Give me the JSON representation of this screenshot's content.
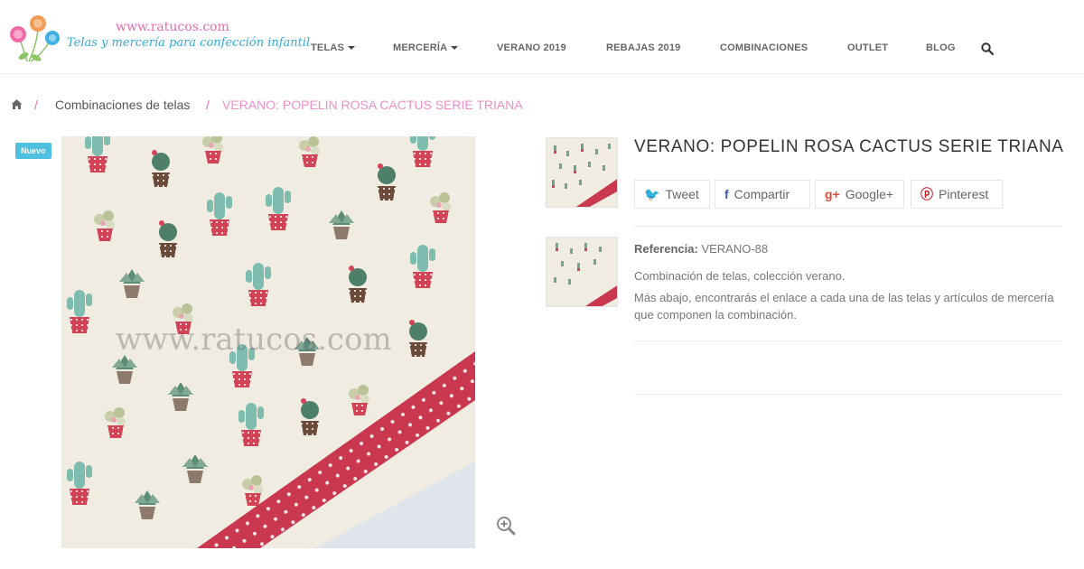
{
  "logo": {
    "url_text": "www.ratucos.com",
    "tagline": "Telas y mercería para confección infantil"
  },
  "nav": {
    "items": [
      {
        "label": "TELAS",
        "dropdown": true
      },
      {
        "label": "MERCERÍA",
        "dropdown": true
      },
      {
        "label": "VERANO 2019",
        "dropdown": false
      },
      {
        "label": "REBAJAS 2019",
        "dropdown": false
      },
      {
        "label": "COMBINACIONES",
        "dropdown": false
      },
      {
        "label": "OUTLET",
        "dropdown": false
      },
      {
        "label": "BLOG",
        "dropdown": false
      }
    ],
    "search_icon": "search-icon"
  },
  "breadcrumb": {
    "home_icon": "home-icon",
    "separator": "/",
    "link": "Combinaciones de telas",
    "current": "VERANO: POPELIN ROSA CACTUS SERIE TRIANA"
  },
  "product": {
    "badge": "Nuevo",
    "watermark": "www.ratucos.com",
    "title": "VERANO: POPELIN ROSA CACTUS SERIE TRIANA",
    "share": {
      "tweet": "Tweet",
      "compartir": "Compartir",
      "google": "Google+",
      "pinterest": "Pinterest"
    },
    "reference_label": "Referencia:",
    "reference_value": "VERANO-88",
    "description_1": "Combinación de telas, colección verano.",
    "description_2": "Más abajo, encontrarás el enlace a cada una de las telas y artículos de mercería que componen la combinación."
  },
  "colors": {
    "pink": "#e86bb0",
    "blue": "#35a9d6",
    "badge": "#4fc0e0",
    "fabric_bg": "#f1ece2",
    "dot_fabric": "#c9384e"
  }
}
